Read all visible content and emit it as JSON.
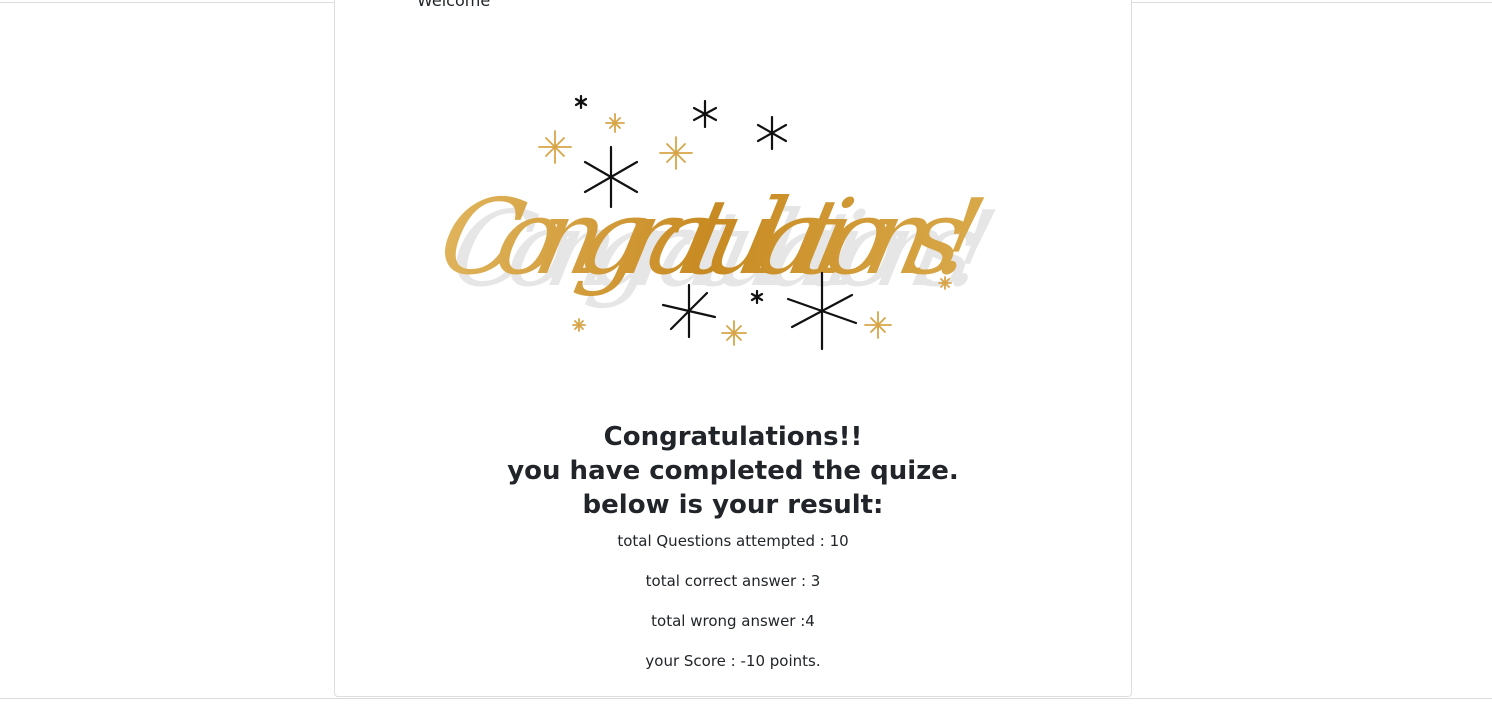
{
  "header": {
    "welcome_text": "Welcome"
  },
  "banner": {
    "image_text": "Congratulations!",
    "colors": {
      "gold": "#cf9a35",
      "star_dark": "#111111",
      "shadow": "#e4e4e4"
    }
  },
  "result": {
    "heading_line1": "Congratulations!!",
    "heading_line2": "you have completed the quize.",
    "heading_line3": "below is your result:",
    "total_attempted": "total Questions attempted : 10",
    "total_correct": "total correct answer : 3",
    "total_wrong": "total wrong answer :4",
    "score": "your Score : -10 points."
  }
}
